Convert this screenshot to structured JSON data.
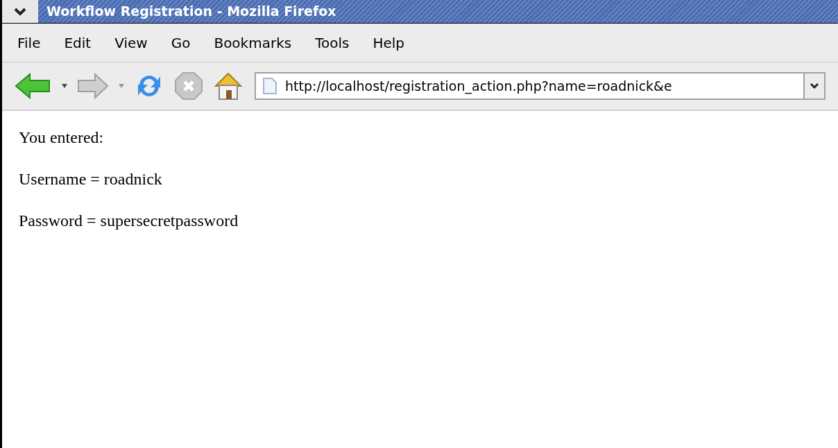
{
  "window": {
    "title": "Workflow Registration - Mozilla Firefox"
  },
  "menu": [
    "File",
    "Edit",
    "View",
    "Go",
    "Bookmarks",
    "Tools",
    "Help"
  ],
  "address_bar": {
    "value": "http://localhost/registration_action.php?name=roadnick&e"
  },
  "content": [
    "You entered:",
    "Username = roadnick",
    "Password = supersecretpassword"
  ]
}
